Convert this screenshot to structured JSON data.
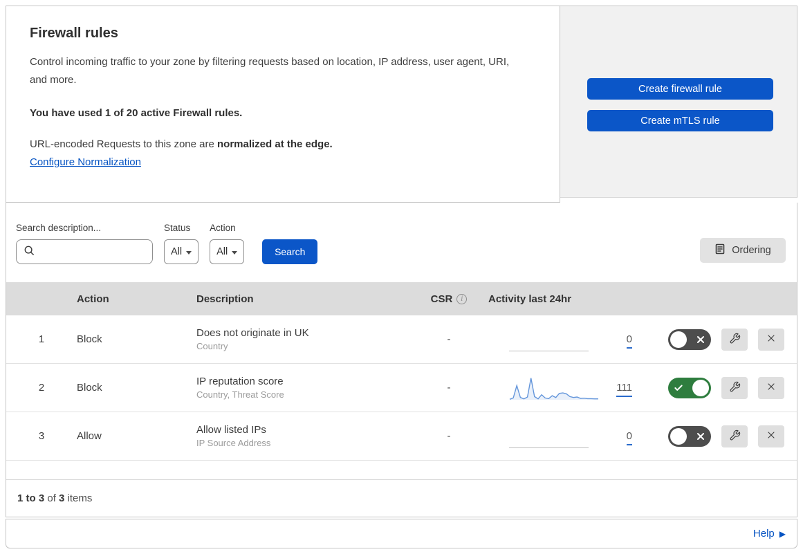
{
  "overview": {
    "title": "Firewall rules",
    "description": "Control incoming traffic to your zone by filtering requests based on location, IP address, user agent, URI, and more.",
    "usage_line": "You have used 1 of 20 active Firewall rules.",
    "normalization_text": "URL-encoded Requests to this zone are",
    "normalization_bold": "normalized at the edge.",
    "normalization_link": "Configure Normalization"
  },
  "cta": {
    "create_firewall_rule": "Create firewall rule",
    "create_mtls_rule": "Create mTLS rule"
  },
  "filters": {
    "search_label": "Search description...",
    "status_label": "Status",
    "status_value": "All",
    "action_label": "Action",
    "action_value": "All",
    "search_button": "Search",
    "ordering_button": "Ordering"
  },
  "table": {
    "headers": {
      "action": "Action",
      "description": "Description",
      "csr": "CSR",
      "activity": "Activity last 24hr"
    },
    "rows": [
      {
        "priority": "1",
        "action": "Block",
        "description": "Does not originate in UK",
        "fields": "Country",
        "csr": "-",
        "activity_count": "0",
        "enabled": false
      },
      {
        "priority": "2",
        "action": "Block",
        "description": "IP reputation score",
        "fields": "Country, Threat Score",
        "csr": "-",
        "activity_count": "111",
        "enabled": true
      },
      {
        "priority": "3",
        "action": "Allow",
        "description": "Allow listed IPs",
        "fields": "IP Source Address",
        "csr": "-",
        "activity_count": "0",
        "enabled": false
      }
    ]
  },
  "footer": {
    "range": "1 to 3",
    "of": " of ",
    "total": "3",
    "items": " items"
  },
  "help": {
    "label": "Help",
    "arrow": "▶"
  },
  "colors": {
    "button_blue": "#0b56c8",
    "link_blue": "#0553c2",
    "toggle_on_green": "#2e7d3e",
    "toggle_off_gray": "#4d4d4d",
    "header_gray": "#dcdcdc",
    "panel_gray": "#f1f1f1",
    "sparkline_blue": "#6496db"
  },
  "chart_data": {
    "type": "area",
    "title": "Activity last 24hr sparkline (rule 2)",
    "total_label": "111",
    "values": [
      2,
      8,
      62,
      10,
      4,
      12,
      95,
      14,
      4,
      22,
      8,
      5,
      18,
      10,
      28,
      30,
      26,
      14,
      10,
      12,
      6,
      7,
      5,
      5,
      4,
      4
    ]
  }
}
